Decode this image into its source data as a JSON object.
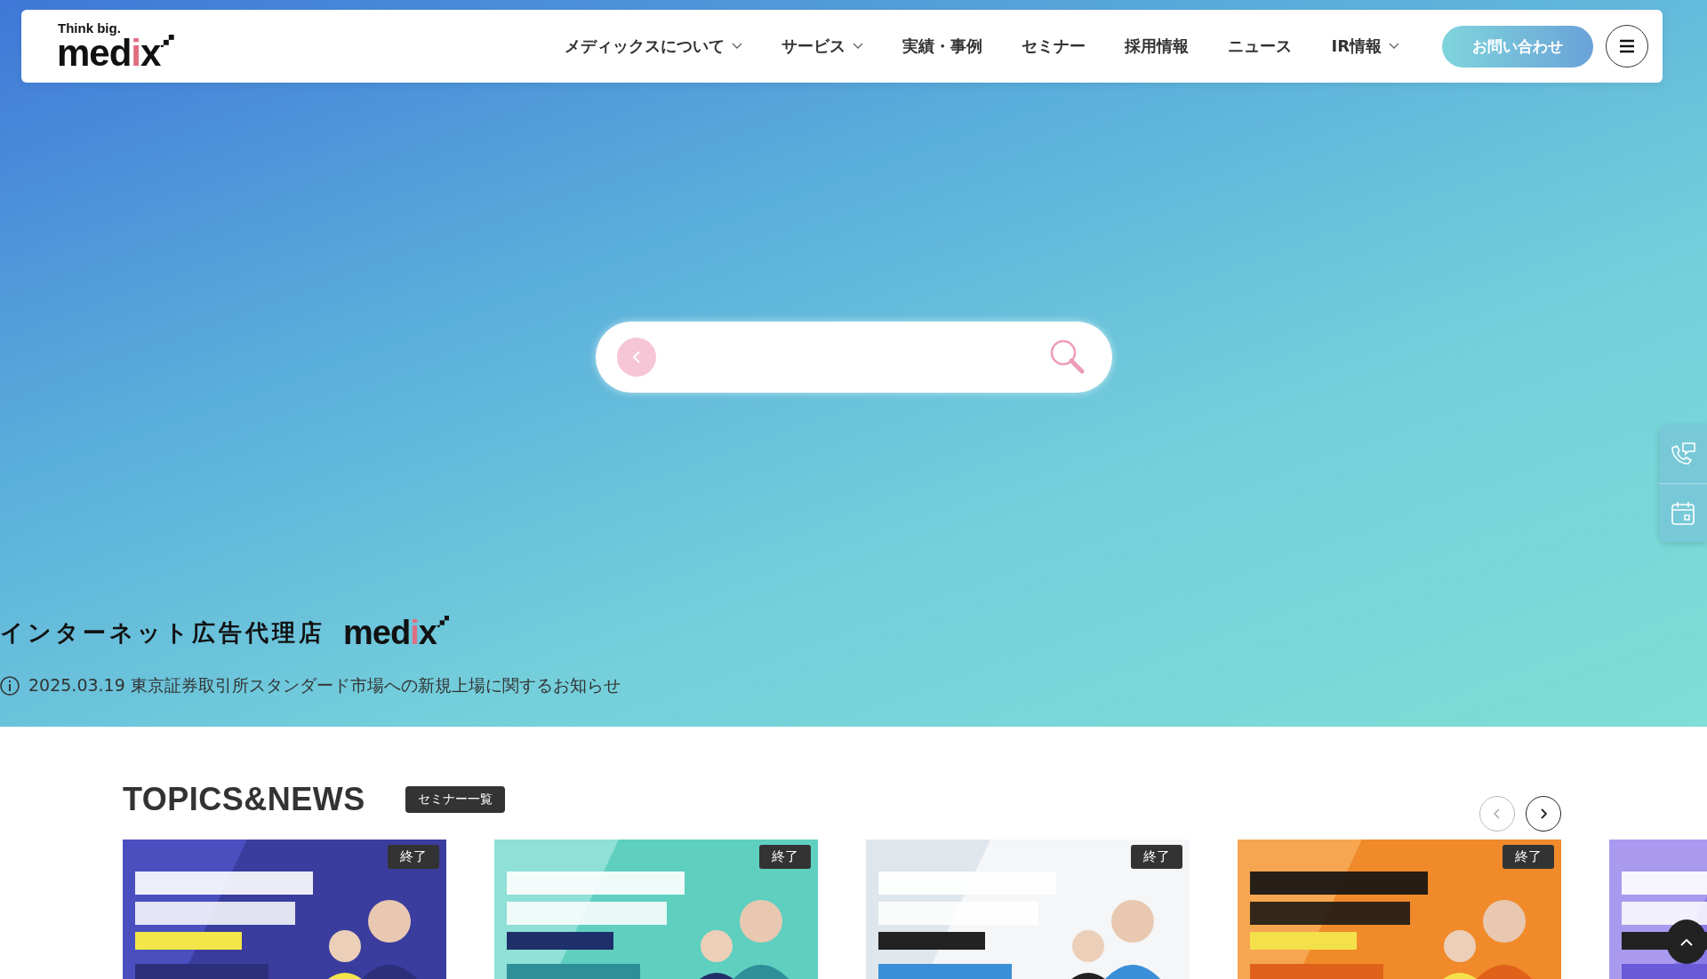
{
  "header": {
    "logo": {
      "tagline": "Think big.",
      "name_start": "med",
      "name_accent": "i",
      "name_end": "x"
    },
    "nav": [
      {
        "label": "メディックスについて",
        "dropdown": true
      },
      {
        "label": "サービス",
        "dropdown": true
      },
      {
        "label": "実績・事例",
        "dropdown": false
      },
      {
        "label": "セミナー",
        "dropdown": false
      },
      {
        "label": "採用情報",
        "dropdown": false
      },
      {
        "label": "ニュース",
        "dropdown": false
      },
      {
        "label": "IR情報",
        "dropdown": true
      }
    ],
    "contact_button": "お問い合わせ"
  },
  "hero": {
    "tagline": "インターネット広告代理店",
    "brand": {
      "name_start": "med",
      "name_accent": "i",
      "name_end": "x"
    },
    "notice": {
      "date": "2025.03.19",
      "text": "東京証券取引所スタンダード市場への新規上場に関するお知らせ"
    }
  },
  "topics": {
    "title": "TOPICS&NEWS",
    "list_button": "セミナー一覧",
    "cards": [
      {
        "kind": "picture",
        "badge": "終了"
      },
      {
        "kind": "picture",
        "badge": "終了"
      },
      {
        "kind": "picture",
        "badge": "終了"
      },
      {
        "kind": "picture",
        "badge": "終了"
      },
      {
        "kind": "picture"
      }
    ]
  }
}
